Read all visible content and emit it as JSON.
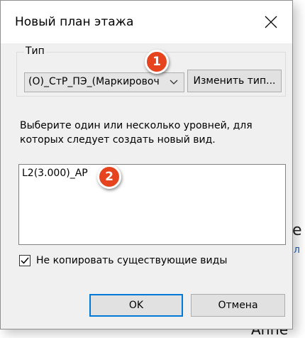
{
  "background": {
    "char1": "е",
    "link": "л",
    "word": "Аппе"
  },
  "dialog": {
    "title": "Новый план этажа",
    "close_icon": "close-icon",
    "type_group": {
      "label": "Тип",
      "selected_value": "(О)_СтР_ПЭ_(Маркировоч",
      "change_type_label": "Изменить тип..."
    },
    "prompt": "Выберите один или несколько уровней, для которых следует создать новый вид.",
    "levels": [
      "L2(3.000)_AP"
    ],
    "checkbox": {
      "label": "Не копировать существующие виды",
      "checked": true
    },
    "ok_label": "OK",
    "cancel_label": "Отмена"
  },
  "callouts": [
    "1",
    "2"
  ],
  "colors": {
    "callout": "#e5441f",
    "accent": "#0078d7"
  }
}
